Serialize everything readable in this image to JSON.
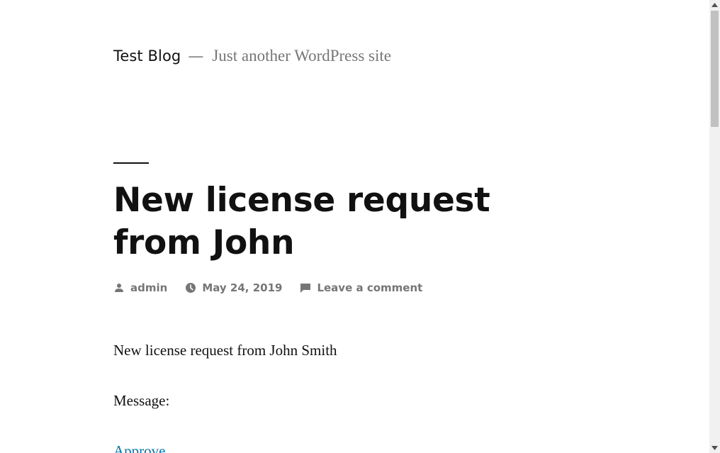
{
  "site": {
    "title": "Test Blog",
    "separator": "—",
    "description": "Just another WordPress site"
  },
  "post": {
    "title": "New license request from John",
    "meta": {
      "author": "admin",
      "date": "May 24, 2019",
      "comments": "Leave a comment"
    },
    "content": {
      "paragraph1": "New license request from John Smith",
      "paragraph2": "Message:",
      "approve_link": "Approve"
    }
  },
  "icons": {
    "author": "person-icon",
    "date": "clock-icon",
    "comments": "comment-bubble-icon"
  },
  "colors": {
    "text": "#111111",
    "muted": "#767676",
    "link": "#0073aa"
  },
  "scrollbar": {
    "position": 0
  }
}
